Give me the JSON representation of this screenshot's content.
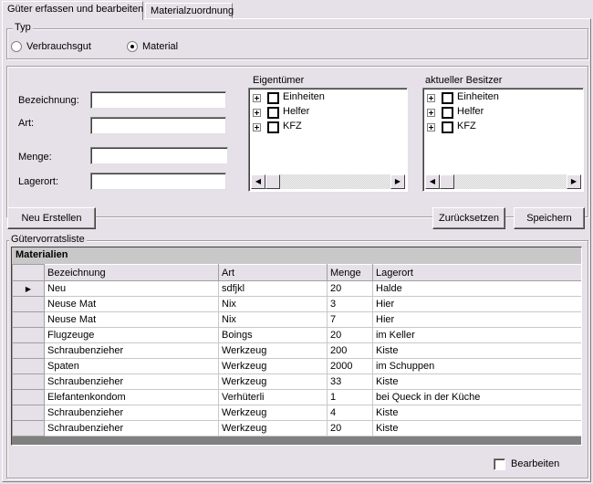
{
  "tabs": [
    {
      "label": "Güter erfassen und bearbeiten",
      "active": true
    },
    {
      "label": "Materialzuordnung",
      "active": false
    }
  ],
  "typ": {
    "legend": "Typ",
    "options": [
      {
        "label": "Verbrauchsgut",
        "checked": false
      },
      {
        "label": "Material",
        "checked": true
      }
    ]
  },
  "form": {
    "fields": [
      {
        "label": "Bezeichnung:",
        "value": ""
      },
      {
        "label": "Art:",
        "value": ""
      },
      {
        "label": "Menge:",
        "value": ""
      },
      {
        "label": "Lagerort:",
        "value": ""
      }
    ]
  },
  "eigentuemer": {
    "label": "Eigentümer",
    "items": [
      "Einheiten",
      "Helfer",
      "KFZ"
    ]
  },
  "besitzer": {
    "label": "aktueller Besitzer",
    "items": [
      "Einheiten",
      "Helfer",
      "KFZ"
    ]
  },
  "buttons": {
    "neu": "Neu Erstellen",
    "reset": "Zurücksetzen",
    "save": "Speichern"
  },
  "liste": {
    "legend": "Gütervorratsliste",
    "caption": "Materialien",
    "columns": [
      "Bezeichnung",
      "Art",
      "Menge",
      "Lagerort"
    ],
    "current_row_marker": "▶",
    "rows": [
      [
        "Neu",
        "sdfjkl",
        "20",
        "Halde"
      ],
      [
        "Neuse Mat",
        "Nix",
        "3",
        "Hier"
      ],
      [
        "Neuse Mat",
        "Nix",
        "7",
        "Hier"
      ],
      [
        "Flugzeuge",
        "Boings",
        "20",
        "im Keller"
      ],
      [
        "Schraubenzieher",
        "Werkzeug",
        "200",
        "Kiste"
      ],
      [
        "Spaten",
        "Werkzeug",
        "2000",
        "im Schuppen"
      ],
      [
        "Schraubenzieher",
        "Werkzeug",
        "33",
        "Kiste"
      ],
      [
        "Elefantenkondom",
        "Verhüterli",
        "1",
        "bei Queck in der Küche"
      ],
      [
        "Schraubenzieher",
        "Werkzeug",
        "4",
        "Kiste"
      ],
      [
        "Schraubenzieher",
        "Werkzeug",
        "20",
        "Kiste"
      ]
    ]
  },
  "bearbeiten": {
    "label": "Bearbeiten",
    "checked": false
  },
  "scroll": {
    "left_arrow": "◀",
    "right_arrow": "▶"
  }
}
